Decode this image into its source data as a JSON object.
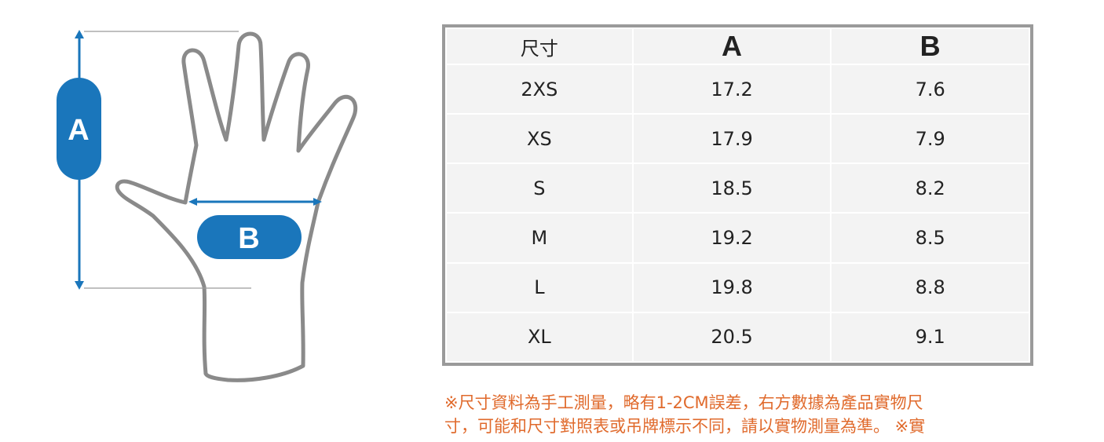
{
  "diagram": {
    "label_a": "A",
    "label_b": "B",
    "accent_color": "#1a76bb",
    "outline_color": "#8a8a8a"
  },
  "size_table": {
    "headers": [
      "尺寸",
      "A",
      "B"
    ],
    "rows": [
      {
        "size": "2XS",
        "a": "17.2",
        "b": "7.6"
      },
      {
        "size": "XS",
        "a": "17.9",
        "b": "7.9"
      },
      {
        "size": "S",
        "a": "18.5",
        "b": "8.2"
      },
      {
        "size": "M",
        "a": "19.2",
        "b": "8.5"
      },
      {
        "size": "L",
        "a": "19.8",
        "b": "8.8"
      },
      {
        "size": "XL",
        "a": "20.5",
        "b": "9.1"
      }
    ]
  },
  "note": {
    "line1": "※尺寸資料為手工測量，略有1-2CM誤差，右方數據為產品實物尺",
    "line2": "寸，可能和尺寸對照表或吊牌標示不同，請以實物測量為準。 ※實",
    "color": "#e06a2c"
  }
}
